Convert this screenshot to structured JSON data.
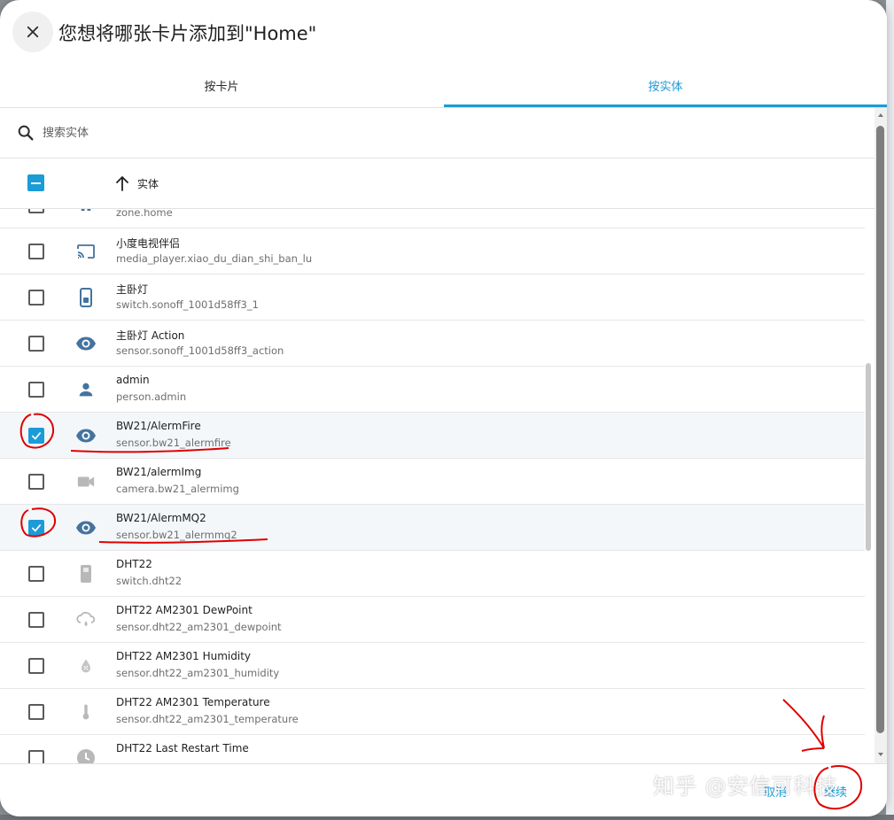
{
  "dialog": {
    "title": "您想将哪张卡片添加到\"Home\"",
    "close_icon": "close-icon"
  },
  "tabs": [
    {
      "label": "按卡片",
      "active": false
    },
    {
      "label": "按实体",
      "active": true
    }
  ],
  "search": {
    "placeholder": "搜索实体",
    "icon": "search-icon"
  },
  "table": {
    "select_all_state": "indeterminate",
    "column_label": "实体",
    "sort": "ascending"
  },
  "rows": [
    {
      "name": "",
      "entity_id": "zone.home",
      "icon": "zone-icon",
      "checked": false
    },
    {
      "name": "小度电视伴侣",
      "entity_id": "media_player.xiao_du_dian_shi_ban_lu",
      "icon": "cast-icon",
      "checked": false
    },
    {
      "name": "主卧灯",
      "entity_id": "switch.sonoff_1001d58ff3_1",
      "icon": "switch-icon",
      "checked": false
    },
    {
      "name": "主卧灯 Action",
      "entity_id": "sensor.sonoff_1001d58ff3_action",
      "icon": "eye-icon",
      "checked": false
    },
    {
      "name": "admin",
      "entity_id": "person.admin",
      "icon": "person-icon",
      "checked": false
    },
    {
      "name": "BW21/AlermFire",
      "entity_id": "sensor.bw21_alermfire",
      "icon": "eye-icon",
      "checked": true
    },
    {
      "name": "BW21/alermImg",
      "entity_id": "camera.bw21_alermimg",
      "icon": "camera-icon",
      "checked": false
    },
    {
      "name": "BW21/AlermMQ2",
      "entity_id": "sensor.bw21_alermmq2",
      "icon": "eye-icon",
      "checked": true
    },
    {
      "name": "DHT22",
      "entity_id": "switch.dht22",
      "icon": "switch-off-icon",
      "checked": false
    },
    {
      "name": "DHT22 AM2301 DewPoint",
      "entity_id": "sensor.dht22_am2301_dewpoint",
      "icon": "dewpoint-icon",
      "checked": false
    },
    {
      "name": "DHT22 AM2301 Humidity",
      "entity_id": "sensor.dht22_am2301_humidity",
      "icon": "humidity-icon",
      "checked": false
    },
    {
      "name": "DHT22 AM2301 Temperature",
      "entity_id": "sensor.dht22_am2301_temperature",
      "icon": "thermometer-icon",
      "checked": false
    },
    {
      "name": "DHT22 Last Restart Time",
      "entity_id": "",
      "icon": "clock-icon",
      "checked": false
    }
  ],
  "footer": {
    "cancel_label": "取消",
    "continue_label": "继续"
  },
  "watermark": "知乎 @安信可科技",
  "colors": {
    "accent": "#1b9bd8",
    "icon": "#44739e",
    "annotation": "#e00000"
  }
}
